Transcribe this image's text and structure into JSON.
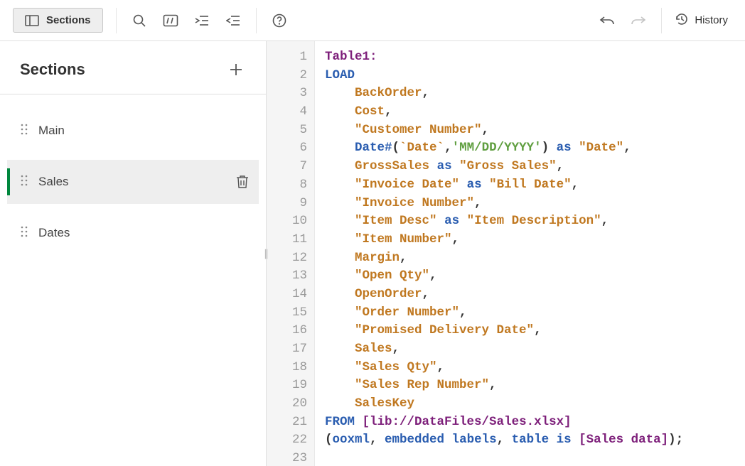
{
  "toolbar": {
    "sections_label": "Sections",
    "history_label": "History"
  },
  "sidebar": {
    "title": "Sections",
    "items": [
      {
        "label": "Main",
        "active": false
      },
      {
        "label": "Sales",
        "active": true
      },
      {
        "label": "Dates",
        "active": false
      }
    ]
  },
  "editor": {
    "line_numbers": [
      "1",
      "2",
      "3",
      "4",
      "5",
      "6",
      "7",
      "8",
      "9",
      "10",
      "11",
      "12",
      "13",
      "14",
      "15",
      "16",
      "17",
      "18",
      "19",
      "20",
      "21",
      "22",
      "23"
    ],
    "script_raw": "Table1:\nLOAD\n    BackOrder,\n    Cost,\n    \"Customer Number\",\n    Date#(`Date`,'MM/DD/YYYY') as \"Date\",\n    GrossSales as \"Gross Sales\",\n    \"Invoice Date\" as \"Bill Date\",\n    \"Invoice Number\",\n    \"Item Desc\" as \"Item Description\",\n    \"Item Number\",\n    Margin,\n    \"Open Qty\",\n    OpenOrder,\n    \"Order Number\",\n    \"Promised Delivery Date\",\n    Sales,\n    \"Sales Qty\",\n    \"Sales Rep Number\",\n    SalesKey\nFROM [lib://DataFiles/Sales.xlsx]\n(ooxml, embedded labels, table is [Sales data]);\n",
    "lines": [
      [
        {
          "cls": "tk-tbl",
          "t": "Table1:"
        }
      ],
      [
        {
          "cls": "tk-kw",
          "t": "LOAD"
        }
      ],
      [
        {
          "cls": "",
          "t": "    "
        },
        {
          "cls": "tk-fld",
          "t": "BackOrder"
        },
        {
          "cls": "tk-plain",
          "t": ","
        }
      ],
      [
        {
          "cls": "",
          "t": "    "
        },
        {
          "cls": "tk-fld",
          "t": "Cost"
        },
        {
          "cls": "tk-plain",
          "t": ","
        }
      ],
      [
        {
          "cls": "",
          "t": "    "
        },
        {
          "cls": "tk-str",
          "t": "\"Customer Number\""
        },
        {
          "cls": "tk-plain",
          "t": ","
        }
      ],
      [
        {
          "cls": "",
          "t": "    "
        },
        {
          "cls": "tk-fn",
          "t": "Date#"
        },
        {
          "cls": "tk-plain",
          "t": "("
        },
        {
          "cls": "tk-fld",
          "t": "`Date`"
        },
        {
          "cls": "tk-plain",
          "t": ","
        },
        {
          "cls": "tk-lit",
          "t": "'MM/DD/YYYY'"
        },
        {
          "cls": "tk-plain",
          "t": ")"
        },
        {
          "cls": "",
          "t": " "
        },
        {
          "cls": "tk-as",
          "t": "as"
        },
        {
          "cls": "",
          "t": " "
        },
        {
          "cls": "tk-str",
          "t": "\"Date\""
        },
        {
          "cls": "tk-plain",
          "t": ","
        }
      ],
      [
        {
          "cls": "",
          "t": "    "
        },
        {
          "cls": "tk-fld",
          "t": "GrossSales"
        },
        {
          "cls": "",
          "t": " "
        },
        {
          "cls": "tk-as",
          "t": "as"
        },
        {
          "cls": "",
          "t": " "
        },
        {
          "cls": "tk-str",
          "t": "\"Gross Sales\""
        },
        {
          "cls": "tk-plain",
          "t": ","
        }
      ],
      [
        {
          "cls": "",
          "t": "    "
        },
        {
          "cls": "tk-str",
          "t": "\"Invoice Date\""
        },
        {
          "cls": "",
          "t": " "
        },
        {
          "cls": "tk-as",
          "t": "as"
        },
        {
          "cls": "",
          "t": " "
        },
        {
          "cls": "tk-str",
          "t": "\"Bill Date\""
        },
        {
          "cls": "tk-plain",
          "t": ","
        }
      ],
      [
        {
          "cls": "",
          "t": "    "
        },
        {
          "cls": "tk-str",
          "t": "\"Invoice Number\""
        },
        {
          "cls": "tk-plain",
          "t": ","
        }
      ],
      [
        {
          "cls": "",
          "t": "    "
        },
        {
          "cls": "tk-str",
          "t": "\"Item Desc\""
        },
        {
          "cls": "",
          "t": " "
        },
        {
          "cls": "tk-as",
          "t": "as"
        },
        {
          "cls": "",
          "t": " "
        },
        {
          "cls": "tk-str",
          "t": "\"Item Description\""
        },
        {
          "cls": "tk-plain",
          "t": ","
        }
      ],
      [
        {
          "cls": "",
          "t": "    "
        },
        {
          "cls": "tk-str",
          "t": "\"Item Number\""
        },
        {
          "cls": "tk-plain",
          "t": ","
        }
      ],
      [
        {
          "cls": "",
          "t": "    "
        },
        {
          "cls": "tk-fld",
          "t": "Margin"
        },
        {
          "cls": "tk-plain",
          "t": ","
        }
      ],
      [
        {
          "cls": "",
          "t": "    "
        },
        {
          "cls": "tk-str",
          "t": "\"Open Qty\""
        },
        {
          "cls": "tk-plain",
          "t": ","
        }
      ],
      [
        {
          "cls": "",
          "t": "    "
        },
        {
          "cls": "tk-fld",
          "t": "OpenOrder"
        },
        {
          "cls": "tk-plain",
          "t": ","
        }
      ],
      [
        {
          "cls": "",
          "t": "    "
        },
        {
          "cls": "tk-str",
          "t": "\"Order Number\""
        },
        {
          "cls": "tk-plain",
          "t": ","
        }
      ],
      [
        {
          "cls": "",
          "t": "    "
        },
        {
          "cls": "tk-str",
          "t": "\"Promised Delivery Date\""
        },
        {
          "cls": "tk-plain",
          "t": ","
        }
      ],
      [
        {
          "cls": "",
          "t": "    "
        },
        {
          "cls": "tk-fld",
          "t": "Sales"
        },
        {
          "cls": "tk-plain",
          "t": ","
        }
      ],
      [
        {
          "cls": "",
          "t": "    "
        },
        {
          "cls": "tk-str",
          "t": "\"Sales Qty\""
        },
        {
          "cls": "tk-plain",
          "t": ","
        }
      ],
      [
        {
          "cls": "",
          "t": "    "
        },
        {
          "cls": "tk-str",
          "t": "\"Sales Rep Number\""
        },
        {
          "cls": "tk-plain",
          "t": ","
        }
      ],
      [
        {
          "cls": "",
          "t": "    "
        },
        {
          "cls": "tk-fld",
          "t": "SalesKey"
        }
      ],
      [
        {
          "cls": "tk-kw",
          "t": "FROM"
        },
        {
          "cls": "",
          "t": " "
        },
        {
          "cls": "tk-sqbr",
          "t": "[lib://DataFiles/Sales.xlsx]"
        }
      ],
      [
        {
          "cls": "tk-plain",
          "t": "("
        },
        {
          "cls": "tk-kw",
          "t": "ooxml"
        },
        {
          "cls": "tk-plain",
          "t": ", "
        },
        {
          "cls": "tk-kw",
          "t": "embedded labels"
        },
        {
          "cls": "tk-plain",
          "t": ", "
        },
        {
          "cls": "tk-kw",
          "t": "table is"
        },
        {
          "cls": "",
          "t": " "
        },
        {
          "cls": "tk-sqbr",
          "t": "[Sales data]"
        },
        {
          "cls": "tk-plain",
          "t": ");"
        }
      ],
      []
    ]
  }
}
